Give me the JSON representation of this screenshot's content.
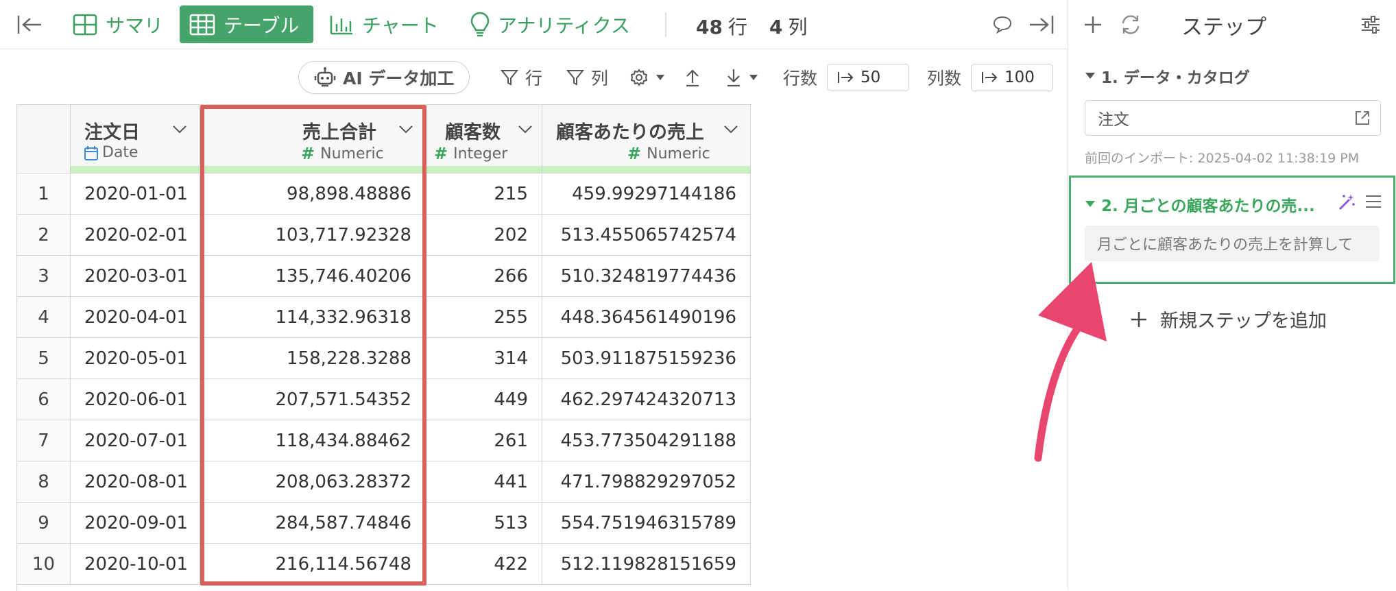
{
  "topbar": {
    "tabs": [
      {
        "label": "サマリ"
      },
      {
        "label": "テーブル"
      },
      {
        "label": "チャート"
      },
      {
        "label": "アナリティクス"
      }
    ],
    "row_count": "48",
    "row_unit": "行",
    "col_count": "4",
    "col_unit": "列"
  },
  "toolbar": {
    "ai_label": "AI データ加工",
    "row_filter_label": "行",
    "col_filter_label": "列",
    "rows_label": "行数",
    "rows_value": "50",
    "cols_label": "列数",
    "cols_value": "100"
  },
  "table": {
    "columns": [
      {
        "name": "注文日",
        "type": "Date"
      },
      {
        "name": "売上合計",
        "type": "Numeric"
      },
      {
        "name": "顧客数",
        "type": "Integer"
      },
      {
        "name": "顧客あたりの売上",
        "type": "Numeric"
      }
    ],
    "rows": [
      {
        "n": "1",
        "date": "2020-01-01",
        "sales": "98,898.48886",
        "customers": "215",
        "per": "459.99297144186"
      },
      {
        "n": "2",
        "date": "2020-02-01",
        "sales": "103,717.92328",
        "customers": "202",
        "per": "513.455065742574"
      },
      {
        "n": "3",
        "date": "2020-03-01",
        "sales": "135,746.40206",
        "customers": "266",
        "per": "510.324819774436"
      },
      {
        "n": "4",
        "date": "2020-04-01",
        "sales": "114,332.96318",
        "customers": "255",
        "per": "448.364561490196"
      },
      {
        "n": "5",
        "date": "2020-05-01",
        "sales": "158,228.3288",
        "customers": "314",
        "per": "503.911875159236"
      },
      {
        "n": "6",
        "date": "2020-06-01",
        "sales": "207,571.54352",
        "customers": "449",
        "per": "462.297424320713"
      },
      {
        "n": "7",
        "date": "2020-07-01",
        "sales": "118,434.88462",
        "customers": "261",
        "per": "453.773504291188"
      },
      {
        "n": "8",
        "date": "2020-08-01",
        "sales": "208,063.28372",
        "customers": "441",
        "per": "471.798829297052"
      },
      {
        "n": "9",
        "date": "2020-09-01",
        "sales": "284,587.74846",
        "customers": "513",
        "per": "554.751946315789"
      },
      {
        "n": "10",
        "date": "2020-10-01",
        "sales": "216,114.56748",
        "customers": "422",
        "per": "512.119828151659"
      }
    ]
  },
  "panel": {
    "title": "ステップ",
    "step1_title": "1. データ・カタログ",
    "step1_source": "注文",
    "step1_import": "前回のインポート: 2025-04-02 11:38:19 PM",
    "step2_title": "2. 月ごとの顧客あたりの売...",
    "step2_desc": "月ごとに顧客あたりの売上を計算して",
    "add_step": "新規ステップを追加"
  },
  "colors": {
    "accent_green": "#46a46b",
    "highlight_red": "#d9605a",
    "arrow_pink": "#e8456f",
    "quality_bar": "#c8f0c0",
    "wand_purple": "#8a5bd0"
  }
}
